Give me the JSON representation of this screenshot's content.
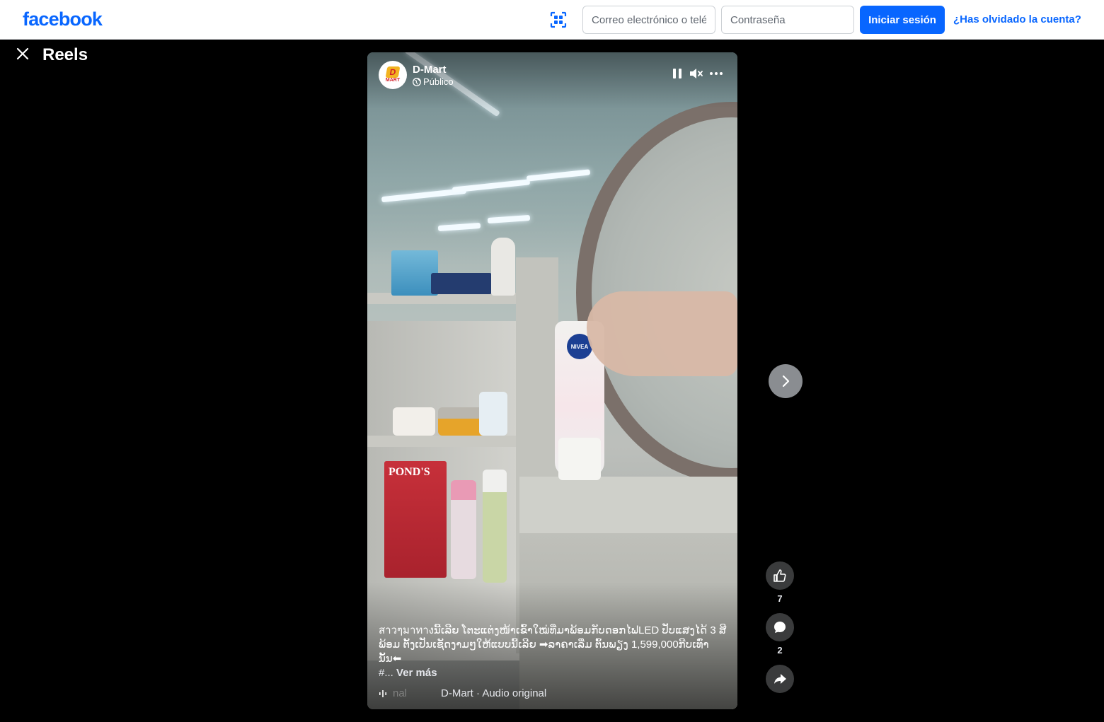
{
  "header": {
    "logo": "facebook",
    "email_placeholder": "Correo electrónico o teléfono",
    "password_placeholder": "Contraseña",
    "login_label": "Iniciar sesión",
    "forgot_label": "¿Has olvidado la cuenta?"
  },
  "reels": {
    "title": "Reels"
  },
  "video": {
    "page_name": "D-Mart",
    "avatar_letter": "D",
    "avatar_sub": "MART",
    "privacy": "Público",
    "product_label": "NIVEA",
    "box_label": "POND'S",
    "caption": "สาวๆมาทางນີ້ເລີຍ ໂຕະແຕ່ງໜ້າເຂົ້າໃໝ່ທີ່ມາພ້ອມກັບດອກໄຟLED ປັບແສງໄດ້ 3 ສີ ພ້ອມ ຕັ້ງເປັນເຊັດງາມໆໃຫ້ແບບນີ້ເລີຍ ➡ລາຄາເລີ່ມ ຕົ້ນພຽງ 1,599,000ກີບເທົ່ານັ້ນ⬅",
    "hashtag_prefix": "#...",
    "see_more": "Ver más",
    "audio_faded": "nal",
    "audio": "D-Mart · Audio original"
  },
  "actions": {
    "likes": "7",
    "comments": "2"
  },
  "colors": {
    "brand": "#0866ff",
    "background": "#000000",
    "action_bg": "#3a3b3c"
  }
}
